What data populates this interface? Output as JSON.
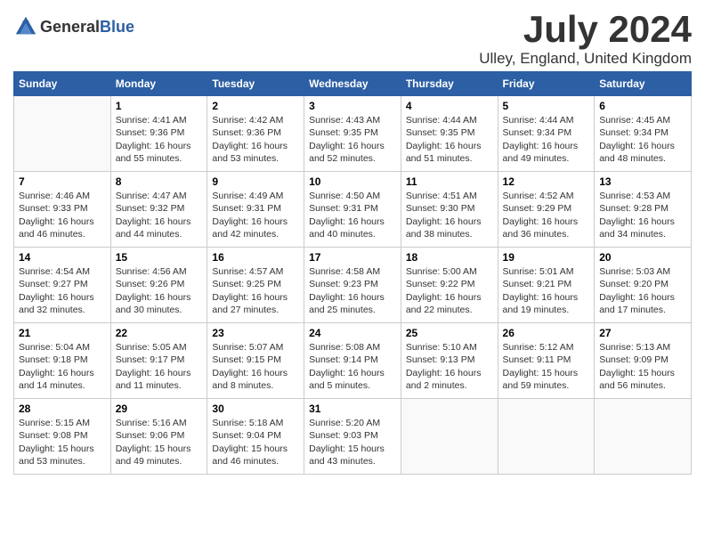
{
  "header": {
    "logo_general": "General",
    "logo_blue": "Blue",
    "month_title": "July 2024",
    "location": "Ulley, England, United Kingdom"
  },
  "days_of_week": [
    "Sunday",
    "Monday",
    "Tuesday",
    "Wednesday",
    "Thursday",
    "Friday",
    "Saturday"
  ],
  "weeks": [
    [
      {
        "day": "",
        "info": ""
      },
      {
        "day": "1",
        "info": "Sunrise: 4:41 AM\nSunset: 9:36 PM\nDaylight: 16 hours\nand 55 minutes."
      },
      {
        "day": "2",
        "info": "Sunrise: 4:42 AM\nSunset: 9:36 PM\nDaylight: 16 hours\nand 53 minutes."
      },
      {
        "day": "3",
        "info": "Sunrise: 4:43 AM\nSunset: 9:35 PM\nDaylight: 16 hours\nand 52 minutes."
      },
      {
        "day": "4",
        "info": "Sunrise: 4:44 AM\nSunset: 9:35 PM\nDaylight: 16 hours\nand 51 minutes."
      },
      {
        "day": "5",
        "info": "Sunrise: 4:44 AM\nSunset: 9:34 PM\nDaylight: 16 hours\nand 49 minutes."
      },
      {
        "day": "6",
        "info": "Sunrise: 4:45 AM\nSunset: 9:34 PM\nDaylight: 16 hours\nand 48 minutes."
      }
    ],
    [
      {
        "day": "7",
        "info": "Sunrise: 4:46 AM\nSunset: 9:33 PM\nDaylight: 16 hours\nand 46 minutes."
      },
      {
        "day": "8",
        "info": "Sunrise: 4:47 AM\nSunset: 9:32 PM\nDaylight: 16 hours\nand 44 minutes."
      },
      {
        "day": "9",
        "info": "Sunrise: 4:49 AM\nSunset: 9:31 PM\nDaylight: 16 hours\nand 42 minutes."
      },
      {
        "day": "10",
        "info": "Sunrise: 4:50 AM\nSunset: 9:31 PM\nDaylight: 16 hours\nand 40 minutes."
      },
      {
        "day": "11",
        "info": "Sunrise: 4:51 AM\nSunset: 9:30 PM\nDaylight: 16 hours\nand 38 minutes."
      },
      {
        "day": "12",
        "info": "Sunrise: 4:52 AM\nSunset: 9:29 PM\nDaylight: 16 hours\nand 36 minutes."
      },
      {
        "day": "13",
        "info": "Sunrise: 4:53 AM\nSunset: 9:28 PM\nDaylight: 16 hours\nand 34 minutes."
      }
    ],
    [
      {
        "day": "14",
        "info": "Sunrise: 4:54 AM\nSunset: 9:27 PM\nDaylight: 16 hours\nand 32 minutes."
      },
      {
        "day": "15",
        "info": "Sunrise: 4:56 AM\nSunset: 9:26 PM\nDaylight: 16 hours\nand 30 minutes."
      },
      {
        "day": "16",
        "info": "Sunrise: 4:57 AM\nSunset: 9:25 PM\nDaylight: 16 hours\nand 27 minutes."
      },
      {
        "day": "17",
        "info": "Sunrise: 4:58 AM\nSunset: 9:23 PM\nDaylight: 16 hours\nand 25 minutes."
      },
      {
        "day": "18",
        "info": "Sunrise: 5:00 AM\nSunset: 9:22 PM\nDaylight: 16 hours\nand 22 minutes."
      },
      {
        "day": "19",
        "info": "Sunrise: 5:01 AM\nSunset: 9:21 PM\nDaylight: 16 hours\nand 19 minutes."
      },
      {
        "day": "20",
        "info": "Sunrise: 5:03 AM\nSunset: 9:20 PM\nDaylight: 16 hours\nand 17 minutes."
      }
    ],
    [
      {
        "day": "21",
        "info": "Sunrise: 5:04 AM\nSunset: 9:18 PM\nDaylight: 16 hours\nand 14 minutes."
      },
      {
        "day": "22",
        "info": "Sunrise: 5:05 AM\nSunset: 9:17 PM\nDaylight: 16 hours\nand 11 minutes."
      },
      {
        "day": "23",
        "info": "Sunrise: 5:07 AM\nSunset: 9:15 PM\nDaylight: 16 hours\nand 8 minutes."
      },
      {
        "day": "24",
        "info": "Sunrise: 5:08 AM\nSunset: 9:14 PM\nDaylight: 16 hours\nand 5 minutes."
      },
      {
        "day": "25",
        "info": "Sunrise: 5:10 AM\nSunset: 9:13 PM\nDaylight: 16 hours\nand 2 minutes."
      },
      {
        "day": "26",
        "info": "Sunrise: 5:12 AM\nSunset: 9:11 PM\nDaylight: 15 hours\nand 59 minutes."
      },
      {
        "day": "27",
        "info": "Sunrise: 5:13 AM\nSunset: 9:09 PM\nDaylight: 15 hours\nand 56 minutes."
      }
    ],
    [
      {
        "day": "28",
        "info": "Sunrise: 5:15 AM\nSunset: 9:08 PM\nDaylight: 15 hours\nand 53 minutes."
      },
      {
        "day": "29",
        "info": "Sunrise: 5:16 AM\nSunset: 9:06 PM\nDaylight: 15 hours\nand 49 minutes."
      },
      {
        "day": "30",
        "info": "Sunrise: 5:18 AM\nSunset: 9:04 PM\nDaylight: 15 hours\nand 46 minutes."
      },
      {
        "day": "31",
        "info": "Sunrise: 5:20 AM\nSunset: 9:03 PM\nDaylight: 15 hours\nand 43 minutes."
      },
      {
        "day": "",
        "info": ""
      },
      {
        "day": "",
        "info": ""
      },
      {
        "day": "",
        "info": ""
      }
    ]
  ]
}
